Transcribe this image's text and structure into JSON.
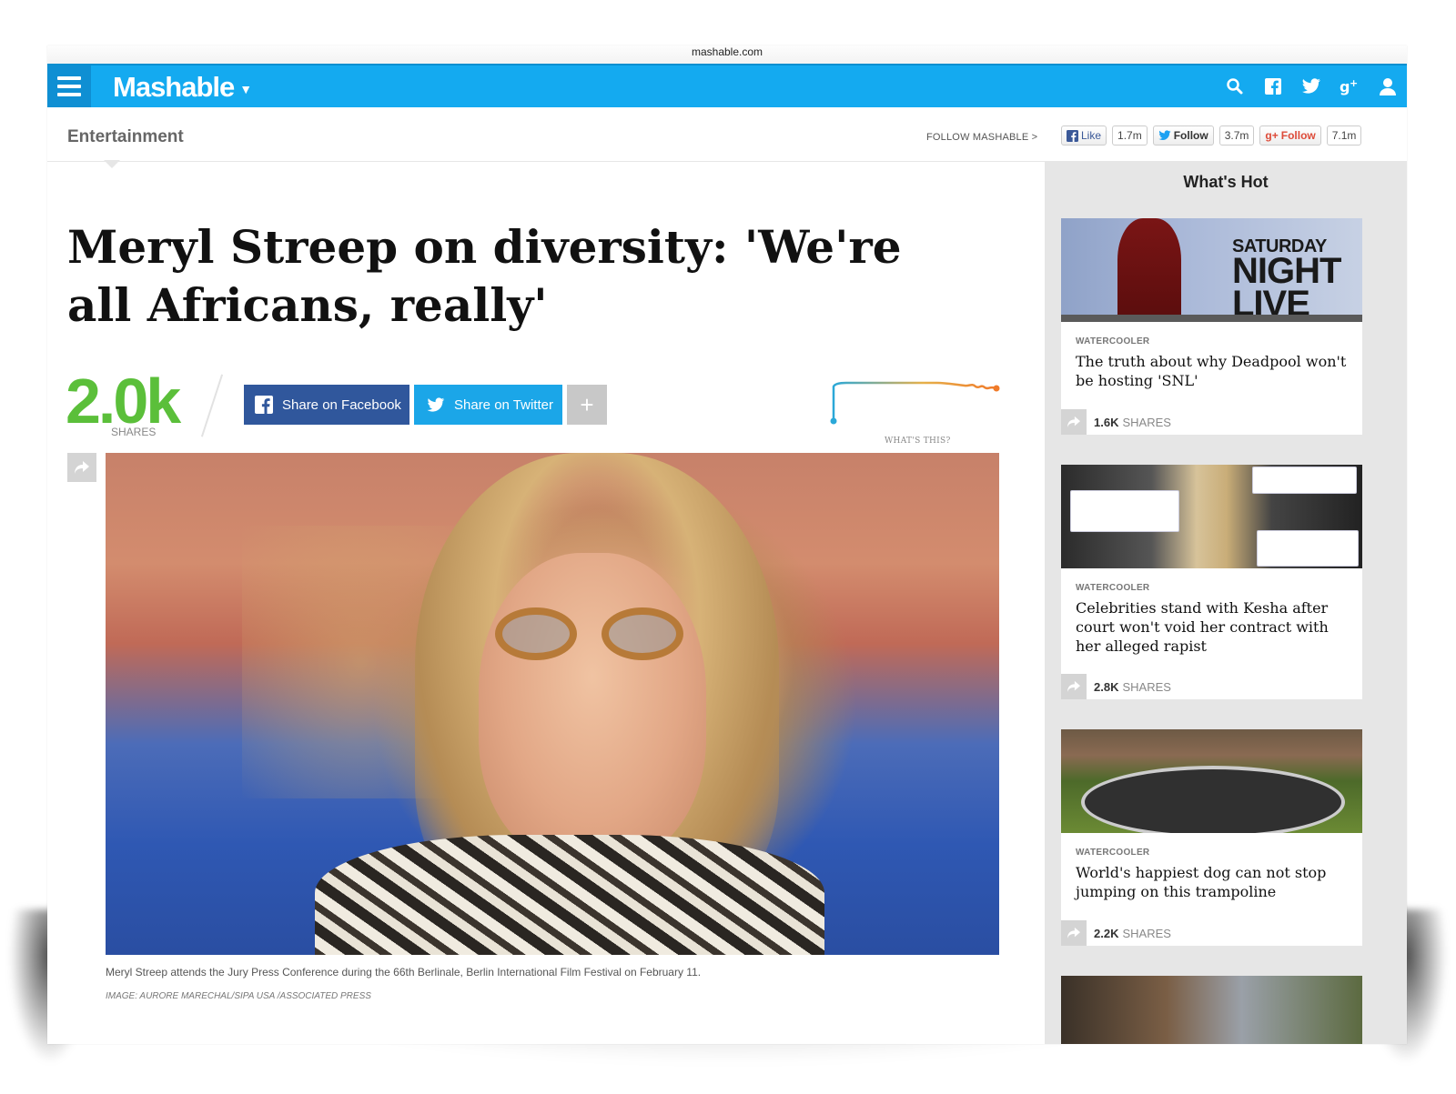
{
  "browser": {
    "address": "mashable.com"
  },
  "topbar": {
    "brand": "Mashable",
    "icons": [
      "menu-icon",
      "search-icon",
      "facebook-icon",
      "twitter-icon",
      "google-plus-icon",
      "user-icon"
    ],
    "accent": "#14aaf0"
  },
  "subbar": {
    "section": "Entertainment",
    "follow_label": "FOLLOW MASHABLE >",
    "facebook": {
      "label": "Like",
      "count": "1.7m"
    },
    "twitter": {
      "label": "Follow",
      "count": "3.7m"
    },
    "googleplus": {
      "label": "Follow",
      "count": "7.1m"
    }
  },
  "article": {
    "headline": "Meryl Streep on diversity: 'We're all Africans, really'",
    "shares": "2.0k",
    "shares_label": "SHARES",
    "share_facebook": "Share on Facebook",
    "share_twitter": "Share on Twitter",
    "share_more": "+",
    "velocity_label": "WHAT'S THIS?",
    "caption": "Meryl Streep attends the Jury Press Conference during the 66th Berlinale, Berlin International Film Festival on February 11.",
    "credit": "IMAGE: AURORE MARECHAL/SIPA USA /ASSOCIATED PRESS"
  },
  "sidebar": {
    "title": "What's Hot",
    "cards": [
      {
        "category": "WATERCOOLER",
        "title": "The truth about why Deadpool won't be hosting 'SNL'",
        "shares": "1.6K",
        "shares_label": "SHARES",
        "image_text_top": "SATURDAY",
        "image_text_mid": "NIGHT",
        "image_text_bot": "LIVE"
      },
      {
        "category": "WATERCOOLER",
        "title": "Celebrities stand with Kesha after court won't void her contract with her alleged rapist",
        "shares": "2.8K",
        "shares_label": "SHARES"
      },
      {
        "category": "WATERCOOLER",
        "title": "World's happiest dog can not stop jumping on this trampoline",
        "shares": "2.2K",
        "shares_label": "SHARES"
      }
    ]
  }
}
